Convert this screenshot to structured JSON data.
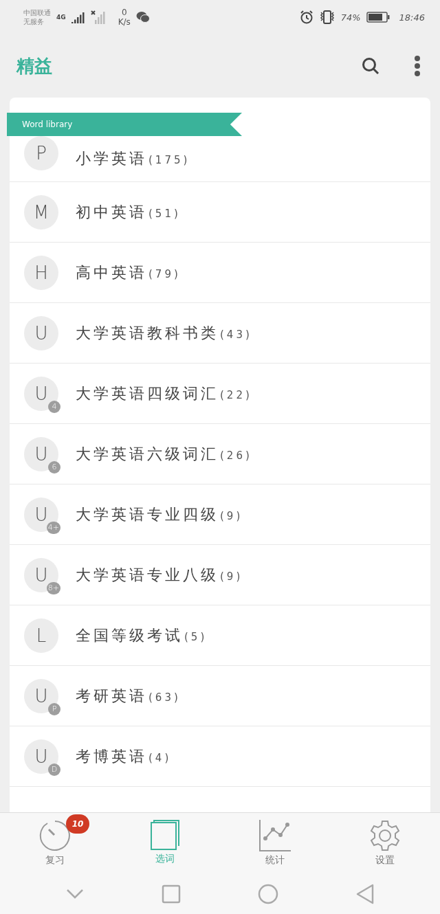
{
  "status_bar": {
    "carrier": [
      "中国联通",
      "无服务"
    ],
    "network": "4G",
    "speed_value": "0",
    "speed_unit": "K/s",
    "battery": "74%",
    "time": "18:46"
  },
  "app_bar": {
    "title": "精益"
  },
  "library": {
    "ribbon": "Word library",
    "items": [
      {
        "letter": "P",
        "name": "小学英语",
        "count": "(175)"
      },
      {
        "letter": "M",
        "name": "初中英语",
        "count": "(51)"
      },
      {
        "letter": "H",
        "name": "高中英语",
        "count": "(79)"
      },
      {
        "letter": "U",
        "name": "大学英语教科书类",
        "count": "(43)"
      },
      {
        "letter": "U",
        "badge": "4",
        "name": "大学英语四级词汇",
        "count": "(22)"
      },
      {
        "letter": "U",
        "badge": "6",
        "name": "大学英语六级词汇",
        "count": "(26)"
      },
      {
        "letter": "U",
        "badge": "4+",
        "name": "大学英语专业四级",
        "count": "(9)"
      },
      {
        "letter": "U",
        "badge": "8+",
        "name": "大学英语专业八级",
        "count": "(9)"
      },
      {
        "letter": "L",
        "name": "全国等级考试",
        "count": "(5)"
      },
      {
        "letter": "U",
        "badge": "P",
        "name": "考研英语",
        "count": "(63)"
      },
      {
        "letter": "U",
        "badge": "D",
        "name": "考博英语",
        "count": "(4)"
      }
    ]
  },
  "bottom_nav": [
    {
      "label": "复习",
      "selected": false,
      "badge": "10"
    },
    {
      "label": "选词",
      "selected": true
    },
    {
      "label": "统计",
      "selected": false
    },
    {
      "label": "设置",
      "selected": false
    }
  ]
}
